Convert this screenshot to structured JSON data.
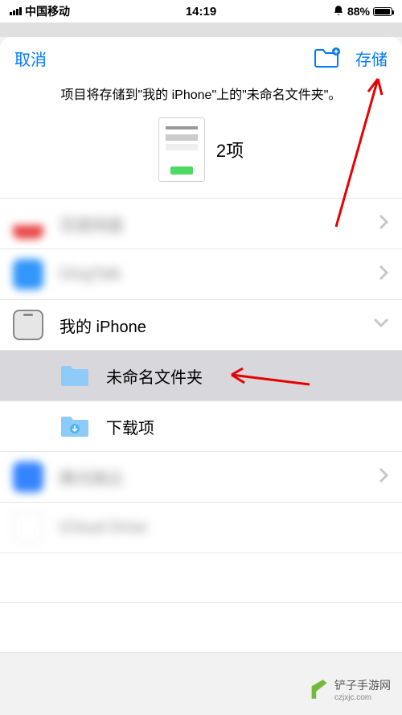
{
  "status": {
    "carrier": "中国移动",
    "time": "14:19",
    "battery": "88%"
  },
  "sheet": {
    "cancel_label": "取消",
    "save_label": "存储",
    "info_text": "项目将存储到\"我的 iPhone\"上的\"未命名文件夹\"。",
    "item_count": "2项"
  },
  "locations": [
    {
      "label": "百度网盘",
      "icon_color": "#e84545",
      "blurred": true
    },
    {
      "label": "DingTalk",
      "icon_color": "#3296fa",
      "blurred": true
    },
    {
      "label": "我的 iPhone",
      "icon_color": "#e6e6e6",
      "blurred": false,
      "expandable": true
    }
  ],
  "subfolders": [
    {
      "label": "未命名文件夹",
      "selected": true
    },
    {
      "label": "下载项",
      "selected": false
    }
  ],
  "extra_locations": [
    {
      "label": "腾讯微云",
      "icon_color": "#3584ff",
      "blurred": true
    },
    {
      "label": "iCloud Drive",
      "icon_color": "#ffffff",
      "blurred": true
    }
  ],
  "watermark": {
    "name": "铲子手游网",
    "url": "czjxjc.com"
  }
}
